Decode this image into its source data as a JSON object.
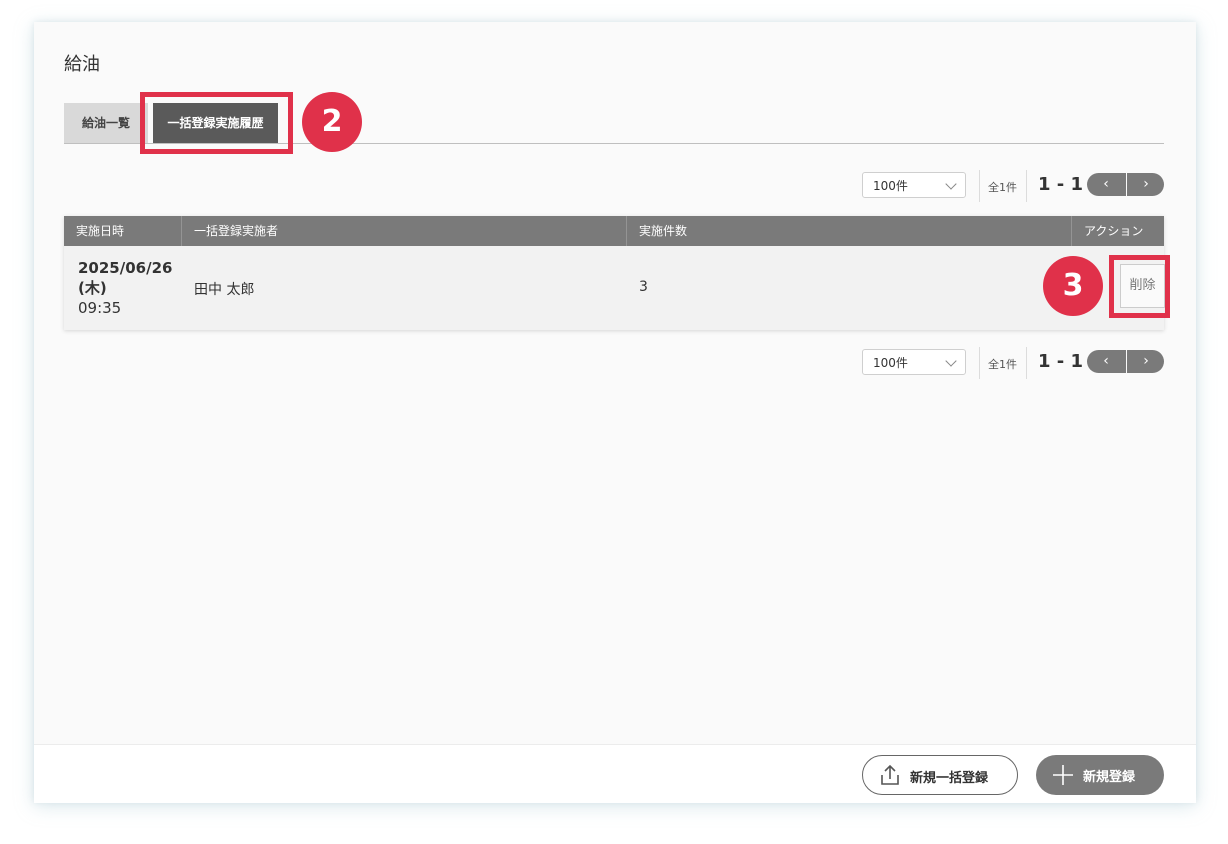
{
  "page": {
    "title": "給油"
  },
  "tabs": [
    {
      "label": "給油一覧",
      "active": false
    },
    {
      "label": "一括登録実施履歴",
      "active": true
    }
  ],
  "annotations": {
    "tab_step": "2",
    "delete_step": "3",
    "highlight_color": "#e0314a"
  },
  "pagination": {
    "per_page": "100件",
    "total": "全1件",
    "range": "1 - 1",
    "prev": "‹",
    "next": "›"
  },
  "table": {
    "headers": [
      "実施日時",
      "一括登録実施者",
      "実施件数",
      "アクション"
    ],
    "rows": [
      {
        "date": "2025/06/26",
        "weekday": "(木)",
        "time": "09:35",
        "user": "田中 太郎",
        "count": "3",
        "action": "削除"
      }
    ]
  },
  "footer": {
    "bulk_button": "新規一括登録",
    "new_button": "新規登録"
  },
  "colors": {
    "header_bg": "#7a7a7a",
    "active_tab": "#5a5a5a",
    "accent": "#e0314a"
  }
}
